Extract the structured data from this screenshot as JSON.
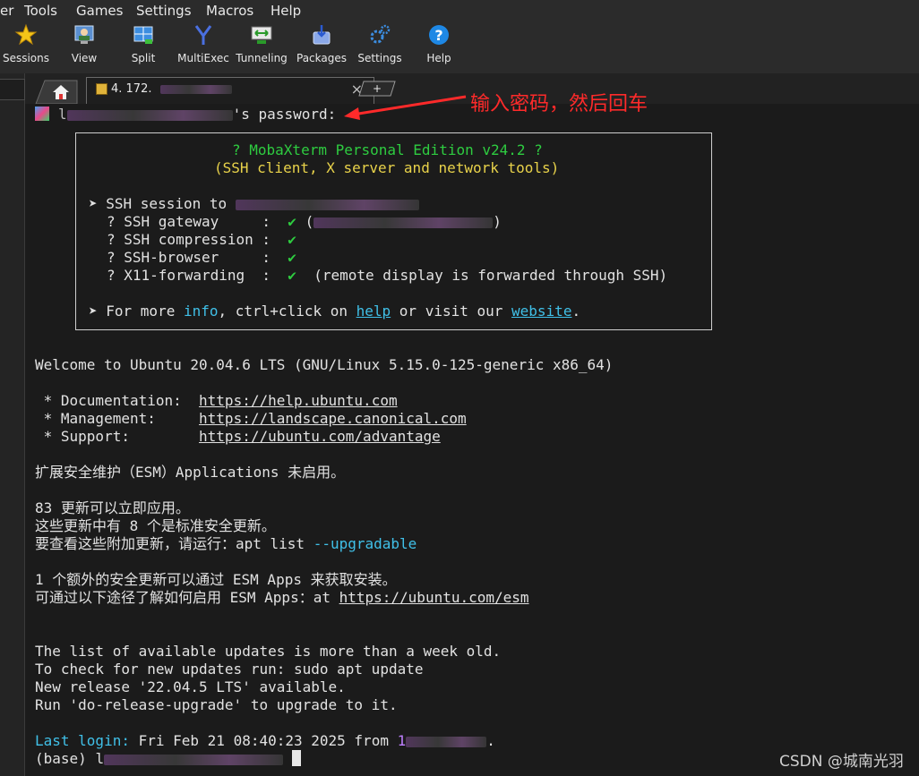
{
  "menu": [
    "er",
    "Tools",
    "Games",
    "Settings",
    "Macros",
    "Help"
  ],
  "toolbar": [
    "Sessions",
    "View",
    "Split",
    "MultiExec",
    "Tunneling",
    "Packages",
    "Settings",
    "Help"
  ],
  "tabs": {
    "session_title": "4. 172.",
    "new_tab": "+"
  },
  "annotation": "输入密码，然后回车",
  "terminal": {
    "prompt_suffix": "'s password:",
    "banner_title": "? MobaXterm Personal Edition v24.2 ?",
    "banner_sub": "(SSH client, X server and network tools)",
    "ssh_session": "➤ SSH session to",
    "items": [
      {
        "label": "? SSH gateway     :",
        "extra": "("
      },
      {
        "label": "? SSH compression :",
        "extra": ""
      },
      {
        "label": "? SSH-browser     :",
        "extra": ""
      },
      {
        "label": "? X11-forwarding  :",
        "extra": "(remote display is forwarded through SSH)"
      }
    ],
    "check": "✔",
    "more_prefix": "➤ For more ",
    "more_info": "info",
    "more_mid": ", ctrl+click on ",
    "more_help": "help",
    "more_mid2": " or visit our ",
    "more_site": "website",
    "more_end": ".",
    "welcome": "Welcome to Ubuntu 20.04.6 LTS (GNU/Linux 5.15.0-125-generic x86_64)",
    "doc_label": " * Documentation:  ",
    "doc_url": "https://help.ubuntu.com",
    "mgmt_label": " * Management:     ",
    "mgmt_url": "https://landscape.canonical.com",
    "sup_label": " * Support:        ",
    "sup_url": "https://ubuntu.com/advantage",
    "esm": "扩展安全维护（ESM）Applications 未启用。",
    "upd1": "83 更新可以立即应用。",
    "upd2": "这些更新中有 8 个是标准安全更新。",
    "upd3_prefix": "要查看这些附加更新，请运行：apt list ",
    "upd3_flag": "--upgradable",
    "esm1": "1 个额外的安全更新可以通过 ESM Apps 来获取安装。",
    "esm2_prefix": "可通过以下途径了解如何启用 ESM Apps：at ",
    "esm2_url": "https://ubuntu.com/esm",
    "list1": "The list of available updates is more than a week old.",
    "list2": "To check for new updates run: sudo apt update",
    "list3": "New release '22.04.5 LTS' available.",
    "list4": "Run 'do-release-upgrade' to upgrade to it.",
    "last_label": "Last login:",
    "last_value": " Fri Feb 21 08:40:23 2025 from ",
    "last_ip_start": "1",
    "last_dot": ".",
    "prompt_base": "(base) ",
    "prompt_l": "l"
  },
  "watermark": "CSDN @城南光羽",
  "colors": {
    "accent_red": "#ff2a2a",
    "green": "#2ecc40",
    "yellow": "#e8d24a",
    "cyan": "#40c0e8"
  }
}
